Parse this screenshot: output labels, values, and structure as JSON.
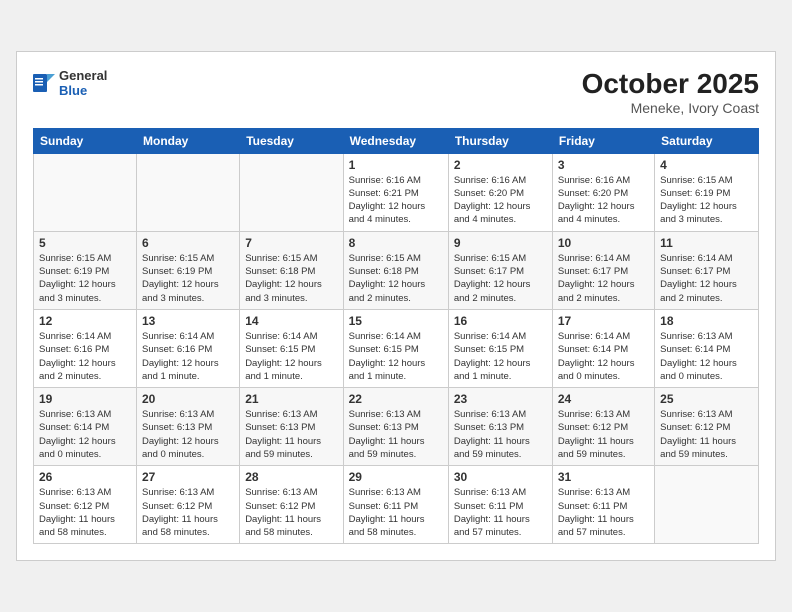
{
  "header": {
    "logo_general": "General",
    "logo_blue": "Blue",
    "month": "October 2025",
    "location": "Meneke, Ivory Coast"
  },
  "weekdays": [
    "Sunday",
    "Monday",
    "Tuesday",
    "Wednesday",
    "Thursday",
    "Friday",
    "Saturday"
  ],
  "weeks": [
    [
      {
        "day": "",
        "info": ""
      },
      {
        "day": "",
        "info": ""
      },
      {
        "day": "",
        "info": ""
      },
      {
        "day": "1",
        "info": "Sunrise: 6:16 AM\nSunset: 6:21 PM\nDaylight: 12 hours\nand 4 minutes."
      },
      {
        "day": "2",
        "info": "Sunrise: 6:16 AM\nSunset: 6:20 PM\nDaylight: 12 hours\nand 4 minutes."
      },
      {
        "day": "3",
        "info": "Sunrise: 6:16 AM\nSunset: 6:20 PM\nDaylight: 12 hours\nand 4 minutes."
      },
      {
        "day": "4",
        "info": "Sunrise: 6:15 AM\nSunset: 6:19 PM\nDaylight: 12 hours\nand 3 minutes."
      }
    ],
    [
      {
        "day": "5",
        "info": "Sunrise: 6:15 AM\nSunset: 6:19 PM\nDaylight: 12 hours\nand 3 minutes."
      },
      {
        "day": "6",
        "info": "Sunrise: 6:15 AM\nSunset: 6:19 PM\nDaylight: 12 hours\nand 3 minutes."
      },
      {
        "day": "7",
        "info": "Sunrise: 6:15 AM\nSunset: 6:18 PM\nDaylight: 12 hours\nand 3 minutes."
      },
      {
        "day": "8",
        "info": "Sunrise: 6:15 AM\nSunset: 6:18 PM\nDaylight: 12 hours\nand 2 minutes."
      },
      {
        "day": "9",
        "info": "Sunrise: 6:15 AM\nSunset: 6:17 PM\nDaylight: 12 hours\nand 2 minutes."
      },
      {
        "day": "10",
        "info": "Sunrise: 6:14 AM\nSunset: 6:17 PM\nDaylight: 12 hours\nand 2 minutes."
      },
      {
        "day": "11",
        "info": "Sunrise: 6:14 AM\nSunset: 6:17 PM\nDaylight: 12 hours\nand 2 minutes."
      }
    ],
    [
      {
        "day": "12",
        "info": "Sunrise: 6:14 AM\nSunset: 6:16 PM\nDaylight: 12 hours\nand 2 minutes."
      },
      {
        "day": "13",
        "info": "Sunrise: 6:14 AM\nSunset: 6:16 PM\nDaylight: 12 hours\nand 1 minute."
      },
      {
        "day": "14",
        "info": "Sunrise: 6:14 AM\nSunset: 6:15 PM\nDaylight: 12 hours\nand 1 minute."
      },
      {
        "day": "15",
        "info": "Sunrise: 6:14 AM\nSunset: 6:15 PM\nDaylight: 12 hours\nand 1 minute."
      },
      {
        "day": "16",
        "info": "Sunrise: 6:14 AM\nSunset: 6:15 PM\nDaylight: 12 hours\nand 1 minute."
      },
      {
        "day": "17",
        "info": "Sunrise: 6:14 AM\nSunset: 6:14 PM\nDaylight: 12 hours\nand 0 minutes."
      },
      {
        "day": "18",
        "info": "Sunrise: 6:13 AM\nSunset: 6:14 PM\nDaylight: 12 hours\nand 0 minutes."
      }
    ],
    [
      {
        "day": "19",
        "info": "Sunrise: 6:13 AM\nSunset: 6:14 PM\nDaylight: 12 hours\nand 0 minutes."
      },
      {
        "day": "20",
        "info": "Sunrise: 6:13 AM\nSunset: 6:13 PM\nDaylight: 12 hours\nand 0 minutes."
      },
      {
        "day": "21",
        "info": "Sunrise: 6:13 AM\nSunset: 6:13 PM\nDaylight: 11 hours\nand 59 minutes."
      },
      {
        "day": "22",
        "info": "Sunrise: 6:13 AM\nSunset: 6:13 PM\nDaylight: 11 hours\nand 59 minutes."
      },
      {
        "day": "23",
        "info": "Sunrise: 6:13 AM\nSunset: 6:13 PM\nDaylight: 11 hours\nand 59 minutes."
      },
      {
        "day": "24",
        "info": "Sunrise: 6:13 AM\nSunset: 6:12 PM\nDaylight: 11 hours\nand 59 minutes."
      },
      {
        "day": "25",
        "info": "Sunrise: 6:13 AM\nSunset: 6:12 PM\nDaylight: 11 hours\nand 59 minutes."
      }
    ],
    [
      {
        "day": "26",
        "info": "Sunrise: 6:13 AM\nSunset: 6:12 PM\nDaylight: 11 hours\nand 58 minutes."
      },
      {
        "day": "27",
        "info": "Sunrise: 6:13 AM\nSunset: 6:12 PM\nDaylight: 11 hours\nand 58 minutes."
      },
      {
        "day": "28",
        "info": "Sunrise: 6:13 AM\nSunset: 6:12 PM\nDaylight: 11 hours\nand 58 minutes."
      },
      {
        "day": "29",
        "info": "Sunrise: 6:13 AM\nSunset: 6:11 PM\nDaylight: 11 hours\nand 58 minutes."
      },
      {
        "day": "30",
        "info": "Sunrise: 6:13 AM\nSunset: 6:11 PM\nDaylight: 11 hours\nand 57 minutes."
      },
      {
        "day": "31",
        "info": "Sunrise: 6:13 AM\nSunset: 6:11 PM\nDaylight: 11 hours\nand 57 minutes."
      },
      {
        "day": "",
        "info": ""
      }
    ]
  ]
}
